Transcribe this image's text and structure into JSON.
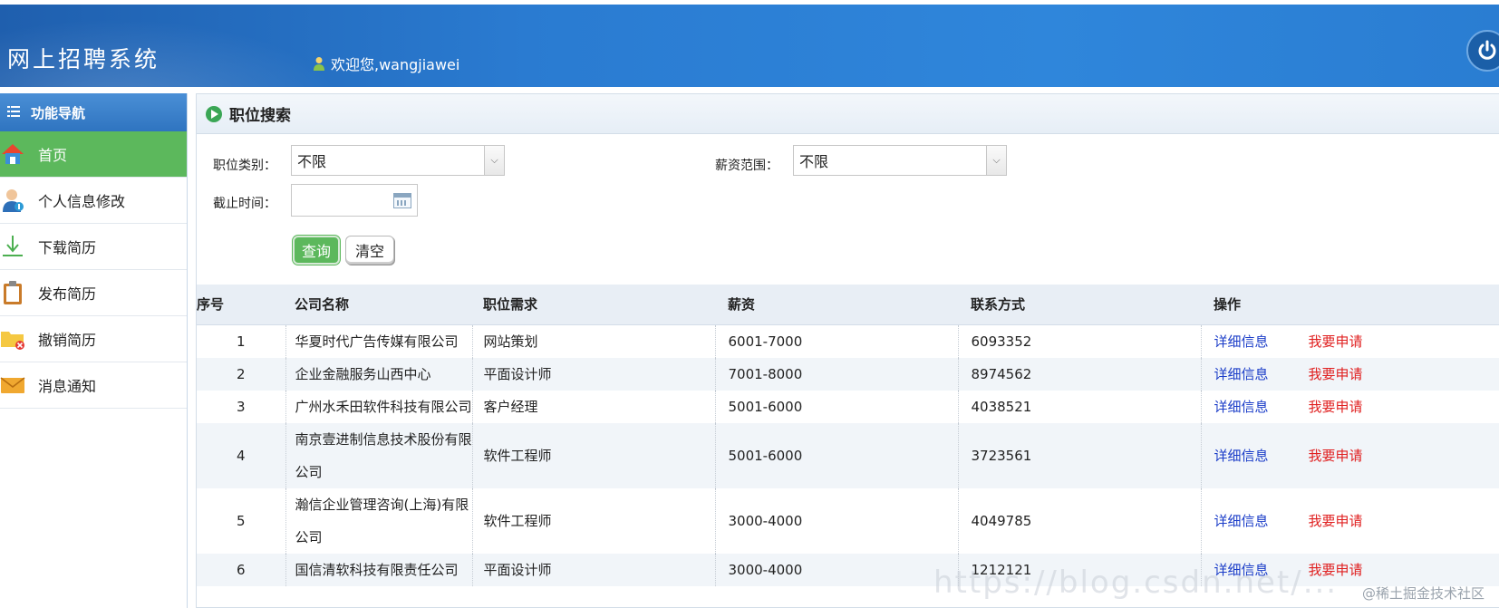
{
  "header": {
    "title": "网上招聘系统",
    "welcome": "欢迎您,wangjiawei"
  },
  "sidebar": {
    "heading": "功能导航",
    "items": [
      {
        "label": "首页",
        "icon": "home-icon",
        "active": true
      },
      {
        "label": "个人信息修改",
        "icon": "user-edit-icon",
        "active": false
      },
      {
        "label": "下载简历",
        "icon": "download-icon",
        "active": false
      },
      {
        "label": "发布简历",
        "icon": "clipboard-icon",
        "active": false
      },
      {
        "label": "撤销简历",
        "icon": "folder-remove-icon",
        "active": false
      },
      {
        "label": "消息通知",
        "icon": "mail-icon",
        "active": false
      }
    ]
  },
  "panel": {
    "title": "职位搜索"
  },
  "search": {
    "category_label": "职位类别：",
    "category_value": "不限",
    "salary_label": "薪资范围：",
    "salary_value": "不限",
    "deadline_label": "截止时间：",
    "deadline_value": "",
    "query_label": "查询",
    "clear_label": "清空"
  },
  "table": {
    "headers": [
      "序号",
      "公司名称",
      "职位需求",
      "薪资",
      "联系方式",
      "操作"
    ],
    "rows": [
      {
        "no": "1",
        "company": "华夏时代广告传媒有限公司",
        "position": "网站策划",
        "salary": "6001-7000",
        "contact": "6093352",
        "detail": "详细信息",
        "apply": "我要申请"
      },
      {
        "no": "2",
        "company": "企业金融服务山西中心",
        "position": "平面设计师",
        "salary": "7001-8000",
        "contact": "8974562",
        "detail": "详细信息",
        "apply": "我要申请"
      },
      {
        "no": "3",
        "company": "广州水禾田软件科技有限公司",
        "position": "客户经理",
        "salary": "5001-6000",
        "contact": "4038521",
        "detail": "详细信息",
        "apply": "我要申请"
      },
      {
        "no": "4",
        "company": "南京壹进制信息技术股份有限公司",
        "position": "软件工程师",
        "salary": "5001-6000",
        "contact": "3723561",
        "detail": "详细信息",
        "apply": "我要申请"
      },
      {
        "no": "5",
        "company": "瀚信企业管理咨询(上海)有限公司",
        "position": "软件工程师",
        "salary": "3000-4000",
        "contact": "4049785",
        "detail": "详细信息",
        "apply": "我要申请"
      },
      {
        "no": "6",
        "company": "国信清软科技有限责任公司",
        "position": "平面设计师",
        "salary": "3000-4000",
        "contact": "1212121",
        "detail": "详细信息",
        "apply": "我要申请"
      }
    ]
  },
  "watermark": {
    "text": "@稀土掘金技术社区",
    "url_overlay": "https://blog.csdn.net/..."
  },
  "colors": {
    "header_blue": "#2a7bd1",
    "active_green": "#5cb85c",
    "link_blue": "#1a3cc8",
    "apply_red": "#e02020"
  }
}
